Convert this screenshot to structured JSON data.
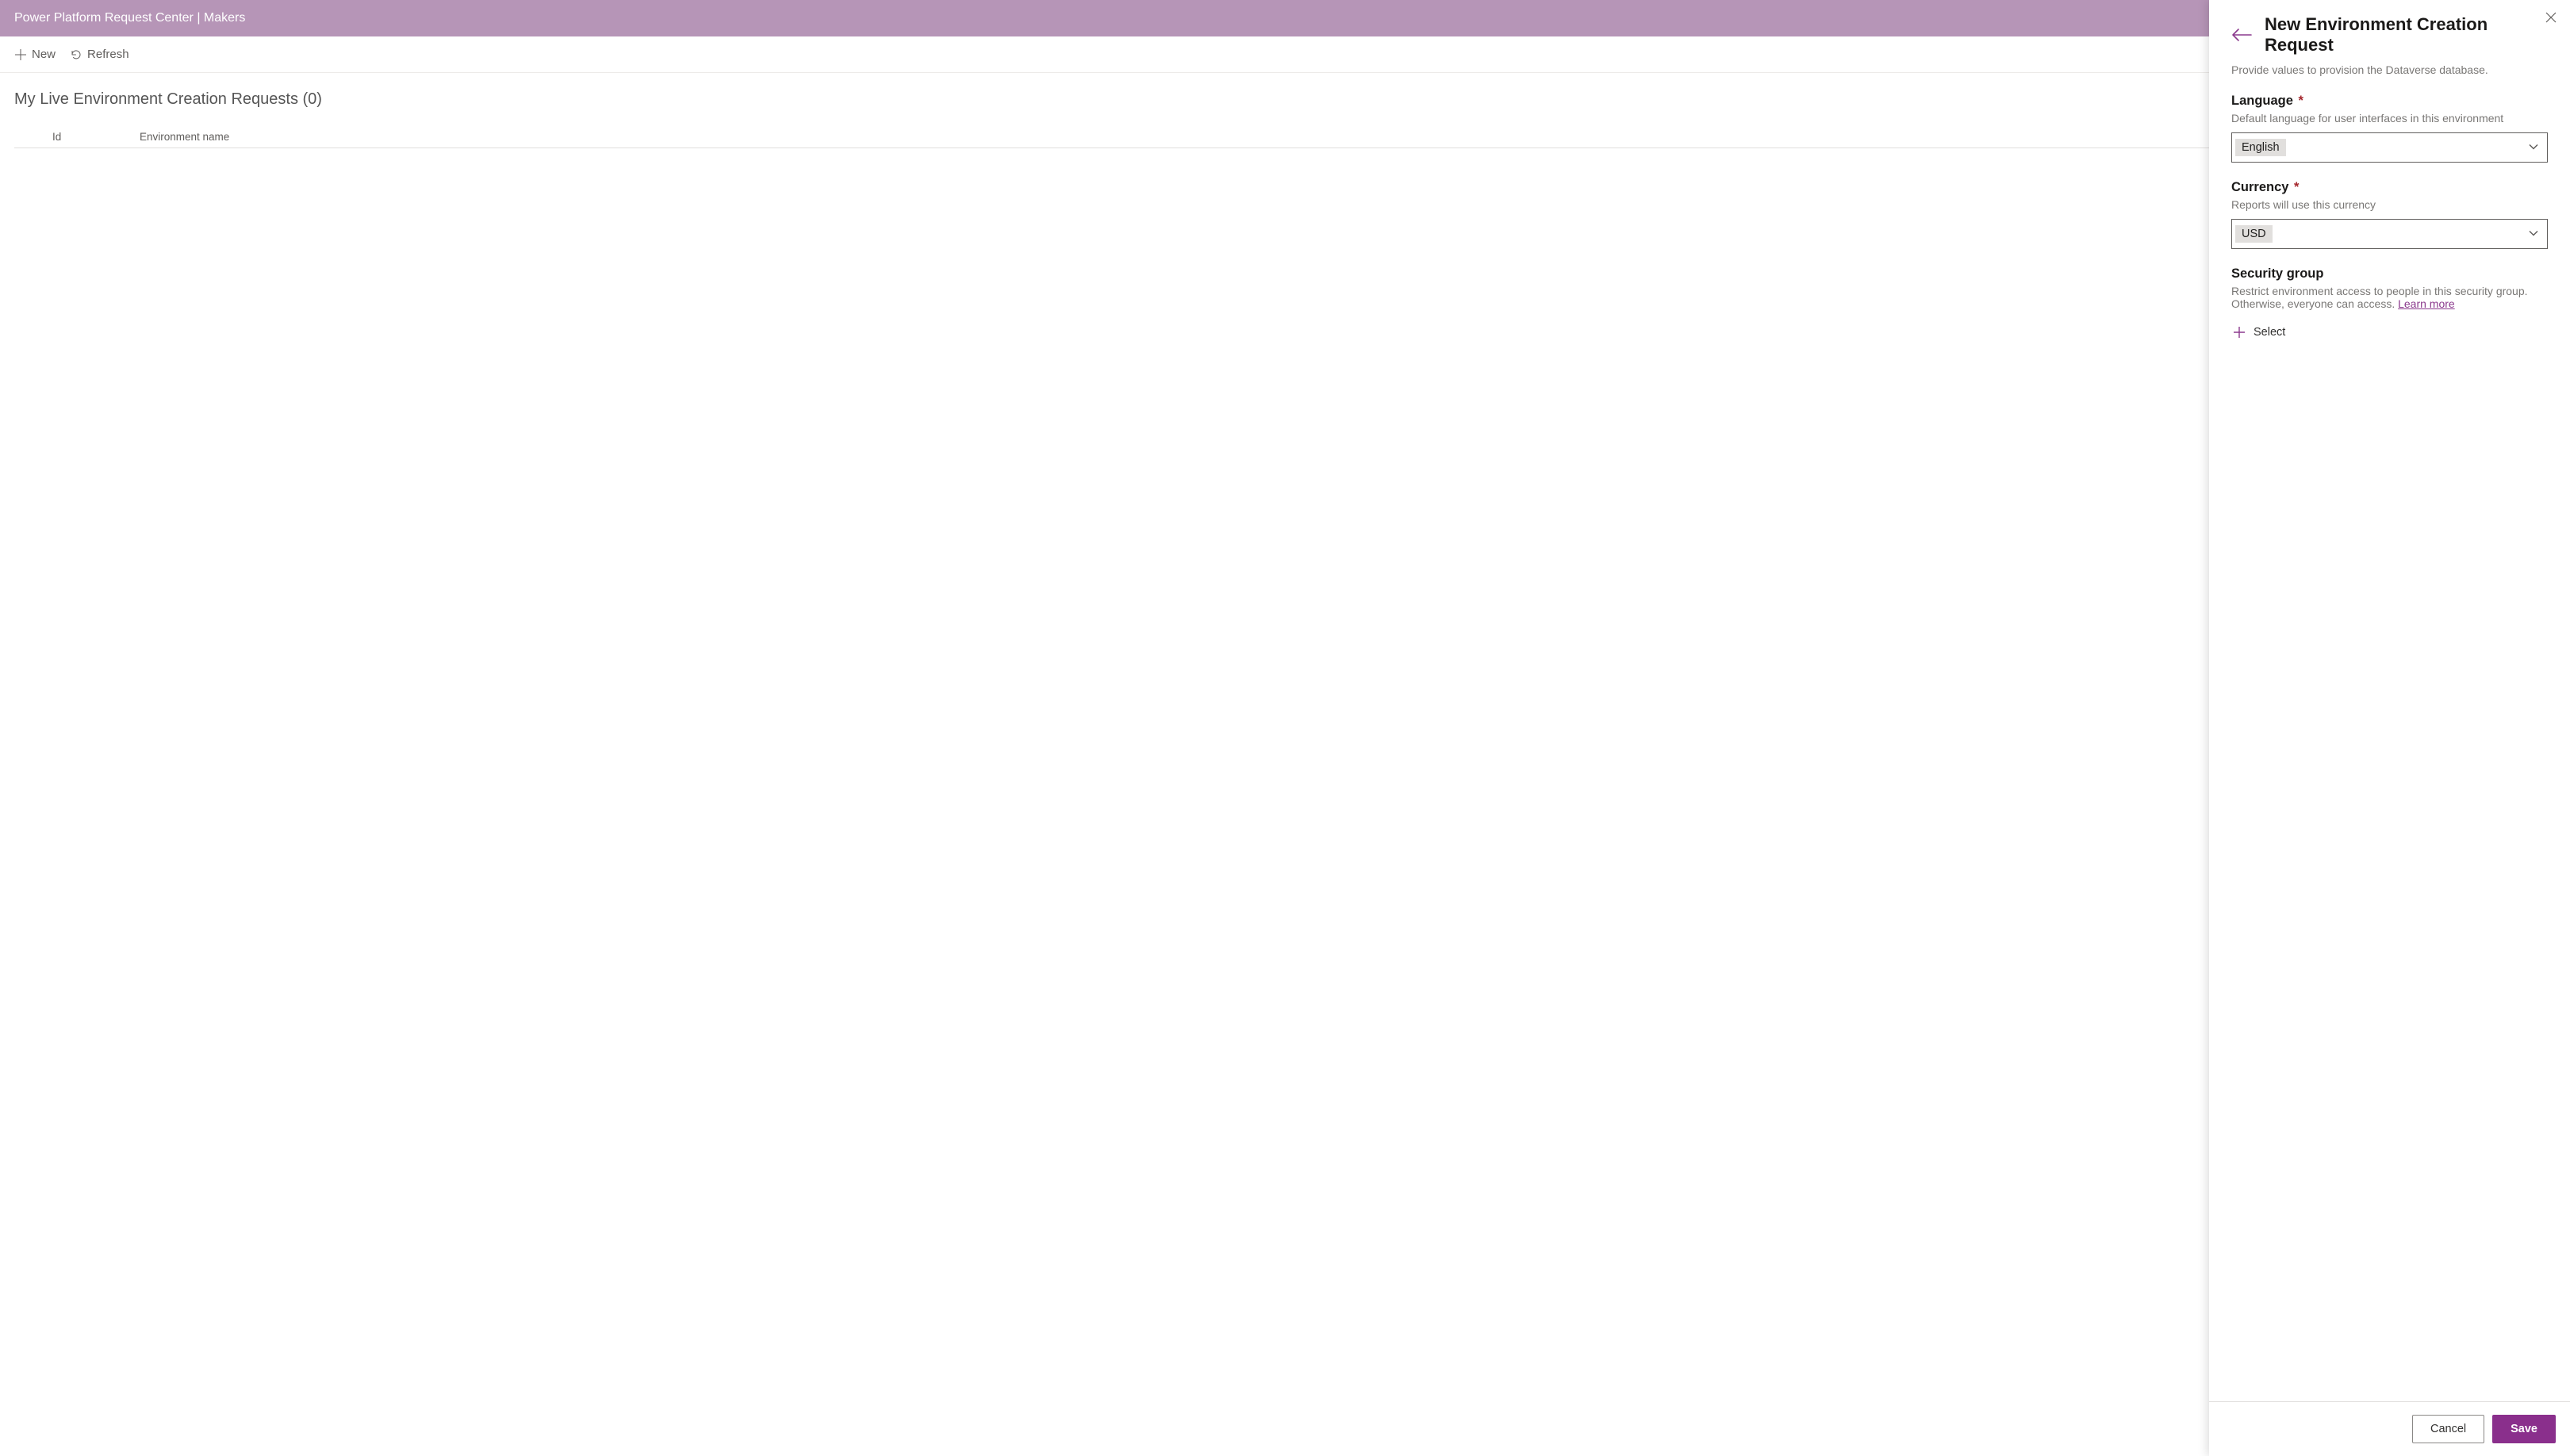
{
  "header": {
    "app_title": "Power Platform Request Center | Makers"
  },
  "commandbar": {
    "new_label": "New",
    "refresh_label": "Refresh"
  },
  "list": {
    "title": "My Live Environment Creation Requests (0)",
    "columns": {
      "id": "Id",
      "env_name": "Environment name"
    }
  },
  "panel": {
    "title": "New Environment Creation Request",
    "subtitle": "Provide values to provision the Dataverse database.",
    "language": {
      "label": "Language",
      "required_marker": "*",
      "description": "Default language for user interfaces in this environment",
      "value": "English"
    },
    "currency": {
      "label": "Currency",
      "required_marker": "*",
      "description": "Reports will use this currency",
      "value": "USD"
    },
    "security_group": {
      "label": "Security group",
      "description_pre": "Restrict environment access to people in this security group. Otherwise, everyone can access. ",
      "learn_more": "Learn more",
      "select_label": "Select"
    },
    "footer": {
      "cancel": "Cancel",
      "save": "Save"
    }
  }
}
